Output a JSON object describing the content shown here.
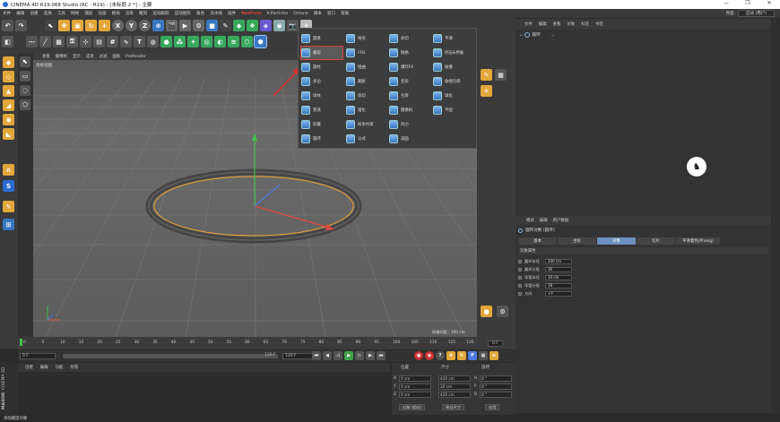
{
  "window": {
    "title": "CINEMA 4D R19.068 Studio (RC - R19) - [未标题 2 *] - 主要",
    "controls": [
      "—",
      "❐",
      "✕"
    ]
  },
  "menubar": {
    "items": [
      "文件",
      "编辑",
      "创建",
      "选择",
      "工具",
      "网格",
      "捕捉",
      "动画",
      "模拟",
      "渲染",
      "雕刻",
      "运动跟踪",
      "运动图形",
      "角色",
      "流水线",
      "插件",
      "RedFlow",
      "X-Particles",
      "Octane",
      "脚本",
      "窗口",
      "帮助"
    ],
    "highlight": "RedFlow",
    "right": {
      "label": "界面:",
      "value": "启动 (用户)"
    }
  },
  "viewport": {
    "menu": [
      "查看",
      "摄像机",
      "显示",
      "选项",
      "过滤",
      "面板",
      "ProRender"
    ],
    "label": "透视视图",
    "scale": "网格间距 : 100 cm",
    "colors": {
      "torus": "#3f3f3f",
      "outline": "#f0a030",
      "grid": "#7a7a7a"
    }
  },
  "popup": {
    "items": [
      {
        "label": "圆盘",
        "icon": "disc-icon"
      },
      {
        "label": "螺旋",
        "icon": "helix-icon",
        "selected": true
      },
      {
        "label": "圆柱",
        "icon": "cylinder-icon"
      },
      {
        "label": "多边",
        "icon": "polygon-icon"
      },
      {
        "label": "球体",
        "icon": "sphere-icon"
      },
      {
        "label": "管道",
        "icon": "tube-icon"
      },
      {
        "label": "胶囊",
        "icon": "capsule-icon"
      },
      {
        "label": "圆环",
        "icon": "torus-icon"
      },
      {
        "label": "地形",
        "icon": "landscape-icon"
      },
      {
        "label": "FFD",
        "icon": "ffd-icon"
      },
      {
        "label": "扭曲",
        "icon": "bend-icon"
      },
      {
        "label": "膨胀",
        "icon": "bulge-icon"
      },
      {
        "label": "斜切",
        "icon": "shear-icon"
      },
      {
        "label": "锥化",
        "icon": "taper-icon"
      },
      {
        "label": "样条约束",
        "icon": "spline-wrap-icon"
      },
      {
        "label": "公式",
        "icon": "formula-icon"
      },
      {
        "label": "斜切",
        "icon": "bevel-icon"
      },
      {
        "label": "网格",
        "icon": "mesh-icon"
      },
      {
        "label": "爆炸FX",
        "icon": "explosion-icon"
      },
      {
        "label": "变形",
        "icon": "morph-icon"
      },
      {
        "label": "包裹",
        "icon": "wrap-icon"
      },
      {
        "label": "摄像机",
        "icon": "camera-icon"
      },
      {
        "label": "风力",
        "icon": "wind-icon"
      },
      {
        "label": "减面",
        "icon": "polygon-reduction-icon"
      },
      {
        "label": "平滑",
        "icon": "smoothing-icon"
      },
      {
        "label": "挤压&伸展",
        "icon": "squash-icon"
      },
      {
        "label": "碰撞",
        "icon": "collision-icon"
      },
      {
        "label": "收缩包裹",
        "icon": "shrink-wrap-icon"
      },
      {
        "label": "球化",
        "icon": "spherify-icon"
      },
      {
        "label": "平面",
        "icon": "plane-icon"
      }
    ]
  },
  "timeline": {
    "ticks": [
      "0",
      "5",
      "10",
      "15",
      "20",
      "25",
      "30",
      "35",
      "40",
      "45",
      "50",
      "55",
      "60",
      "65",
      "70",
      "75",
      "80",
      "85",
      "90",
      "95",
      "100",
      "105",
      "110",
      "115",
      "120"
    ],
    "frame_end_label": "0 F",
    "start": "0 F",
    "current": "0 F",
    "end": "120 F",
    "max": "120 F"
  },
  "material_bar": {
    "items": [
      "创建",
      "编辑",
      "功能",
      "纹理"
    ]
  },
  "coords": {
    "headers": [
      "位置",
      "尺寸",
      "旋转"
    ],
    "rows": [
      {
        "axis": "X",
        "pos": "0 cm",
        "size": "420 cm",
        "rot_axis": "H",
        "rot": "0 °"
      },
      {
        "axis": "Y",
        "pos": "0 cm",
        "size": "20 cm",
        "rot_axis": "P",
        "rot": "0 °"
      },
      {
        "axis": "Z",
        "pos": "0 cm",
        "size": "420 cm",
        "rot_axis": "B",
        "rot": "0 °"
      }
    ],
    "mode1": "对象 (相对)",
    "mode2": "绝对尺寸",
    "apply": "应用"
  },
  "object_manager": {
    "menu": [
      "文件",
      "编辑",
      "查看",
      "对象",
      "标签",
      "书签"
    ],
    "object_name": "圆环"
  },
  "attributes": {
    "menu": [
      "模式",
      "编辑",
      "用户数据"
    ],
    "title": "圆环对象 [圆环]",
    "tabs": [
      "基本",
      "坐标",
      "对象",
      "切片",
      "平滑着色(Phong)"
    ],
    "active_tab": "对象",
    "section": "对象属性",
    "props": [
      {
        "label": "圆环半径",
        "value": "200 cm"
      },
      {
        "label": "圆环分段",
        "value": "36"
      },
      {
        "label": "导管半径",
        "value": "10 cm"
      },
      {
        "label": "导管分段",
        "value": "18"
      },
      {
        "label": "方向",
        "value": "+Y"
      }
    ]
  },
  "status": {
    "text": "添加螺旋对象"
  },
  "logo": {
    "brand": "MAXON",
    "product": "CINEMA 4D"
  }
}
